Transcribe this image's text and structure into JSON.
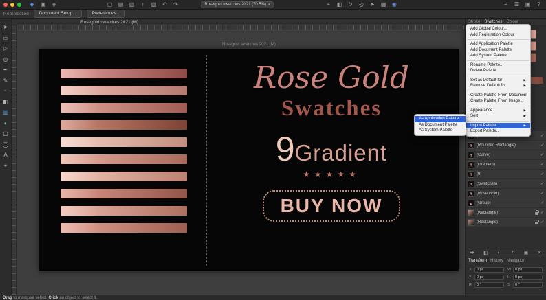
{
  "titlebar": {
    "document_dropdown": "Rosegold swatches 2021 (70.5%)",
    "left_icons": [
      {
        "name": "persona-designer-icon",
        "glyph": "◆",
        "color": "#5a8ee0"
      },
      {
        "name": "persona-pixel-icon",
        "glyph": "▣"
      },
      {
        "name": "persona-export-icon",
        "glyph": "◈"
      }
    ],
    "mid_icons": [
      {
        "name": "new-document-icon",
        "glyph": "▢"
      },
      {
        "name": "open-document-icon",
        "glyph": "▤"
      },
      {
        "name": "save-document-icon",
        "glyph": "▥"
      },
      {
        "name": "export-icon",
        "glyph": "↑"
      },
      {
        "name": "place-image-icon",
        "glyph": "▧"
      },
      {
        "name": "undo-icon",
        "glyph": "↶"
      },
      {
        "name": "redo-icon",
        "glyph": "↷"
      }
    ],
    "right_icons": [
      {
        "name": "snapping-icon",
        "glyph": "⌖"
      },
      {
        "name": "transform-origin-icon",
        "glyph": "◧"
      },
      {
        "name": "rotate-icon",
        "glyph": "↻"
      },
      {
        "name": "zoom-icon",
        "glyph": "◎"
      },
      {
        "name": "pointer-icon",
        "glyph": "➤"
      },
      {
        "name": "grid-icon",
        "glyph": "▦"
      },
      {
        "name": "colour-sync-icon",
        "glyph": "◉",
        "color": "#6a8fe0"
      }
    ],
    "far_right_icons": [
      {
        "name": "separator-toggle-icon",
        "glyph": "≡"
      },
      {
        "name": "hamburger-menu-icon",
        "glyph": "☰"
      },
      {
        "name": "panel-toggle-icon",
        "glyph": "▣"
      },
      {
        "name": "help-icon",
        "glyph": "?"
      }
    ]
  },
  "context_bar": {
    "selection_status": "No Selection",
    "document_setup_label": "Document Setup...",
    "preferences_label": "Preferences..."
  },
  "toolbox": {
    "tools": [
      {
        "name": "move-tool",
        "glyph": "➤"
      },
      {
        "name": "artboard-tool",
        "glyph": "▭"
      },
      {
        "name": "node-tool",
        "glyph": "▷"
      },
      {
        "name": "zoom-tool",
        "glyph": "◎"
      },
      {
        "name": "pen-tool",
        "glyph": "✒"
      },
      {
        "name": "pencil-tool",
        "glyph": "✎"
      },
      {
        "name": "brush-tool",
        "glyph": "~"
      },
      {
        "name": "fill-tool",
        "glyph": "◧"
      },
      {
        "name": "gradient-tool",
        "glyph": "▥",
        "color": "#5aa0d8"
      },
      {
        "name": "transparency-tool",
        "glyph": "◐",
        "color": "#49b6c0"
      },
      {
        "name": "rectangle-tool",
        "glyph": "▢"
      },
      {
        "name": "ellipse-tool",
        "glyph": "◯"
      },
      {
        "name": "text-tool",
        "glyph": "A"
      },
      {
        "name": "colour-picker-tool",
        "glyph": "+"
      }
    ]
  },
  "canvas": {
    "document_tab": "Rosegold swatches 2021 (M)",
    "artboard_name": "Rosegold swatches 2021 (M)"
  },
  "design": {
    "title_line1": "Rose Gold",
    "title_line2": "Swatches",
    "gradient_number": "9",
    "gradient_word": "Gradient",
    "stars": "★★★★★",
    "cta": "BUY NOW",
    "colors": {
      "artboard_bg": "#060606",
      "script": "#c9827c",
      "subtitle": "#a3574c",
      "number": "#eecaba",
      "gradient_word": "#d7a093",
      "stars": "#b2736a",
      "cta": "#e9b6a7",
      "cta_border": "#c48b7c"
    },
    "swatches": [
      {
        "from": "#e2a099",
        "to": "#8e4a47"
      },
      {
        "from": "#f0bfb4",
        "to": "#b37a70"
      },
      {
        "from": "#e3a79b",
        "to": "#a05c52"
      },
      {
        "from": "#cf8a76",
        "to": "#7e4335"
      },
      {
        "from": "#f4d0c3",
        "to": "#c18e80"
      },
      {
        "from": "#e9b0a1",
        "to": "#a96a5b"
      },
      {
        "from": "#f2c6b9",
        "to": "#bb8273"
      },
      {
        "from": "#dd9a8c",
        "to": "#94554a"
      },
      {
        "from": "#eeb9ab",
        "to": "#ad6f60"
      },
      {
        "from": "#e5a494",
        "to": "#9d5f52"
      }
    ]
  },
  "menu": {
    "highlight_color": "#2e62d9",
    "items": [
      {
        "label": "Add Global Colour...",
        "type": "item"
      },
      {
        "label": "Add Registration Colour",
        "type": "item"
      },
      {
        "type": "separator"
      },
      {
        "label": "Add Application Palette",
        "type": "item"
      },
      {
        "label": "Add Document Palette",
        "type": "item"
      },
      {
        "label": "Add System Palette",
        "type": "item"
      },
      {
        "type": "separator"
      },
      {
        "label": "Rename Palette...",
        "type": "item"
      },
      {
        "label": "Delete Palette",
        "type": "item"
      },
      {
        "type": "separator"
      },
      {
        "label": "Set as Default for",
        "type": "item",
        "submenu": true
      },
      {
        "label": "Remove Default for",
        "type": "item",
        "submenu": true
      },
      {
        "type": "separator"
      },
      {
        "label": "Create Palette From Document",
        "type": "item"
      },
      {
        "label": "Create Palette From Image...",
        "type": "item"
      },
      {
        "type": "separator"
      },
      {
        "label": "Appearance",
        "type": "item",
        "submenu": true
      },
      {
        "label": "Sort",
        "type": "item",
        "submenu": true
      },
      {
        "type": "separator"
      },
      {
        "label": "Import Palette...",
        "type": "item",
        "submenu": true,
        "highlighted": true
      },
      {
        "label": "Export Palette...",
        "type": "item"
      }
    ],
    "submenu": {
      "items": [
        {
          "label": "As Application Palette",
          "highlighted": true
        },
        {
          "label": "As Document Palette"
        },
        {
          "label": "As System Palette"
        }
      ]
    }
  },
  "panels": {
    "tabs": [
      "Stroke",
      "Swatches",
      "Colour"
    ],
    "swatch_chips": [
      "#e8b3a9",
      "#d79a8f",
      "#c97b62",
      "#f0c5ba",
      "#b96a58",
      "#e5a89e",
      "#d49588",
      "#eec9bd",
      "#cf8b82",
      "#a95f54",
      "#f2c6b9",
      "#dd9a8c",
      "#e3a79b",
      "#b37a70",
      "#8e4a47",
      "#e2a099",
      "#f4d0c3",
      "#a96a5b",
      "#eeb9ab",
      "#9d5f52"
    ],
    "swatch_gradient": {
      "from": "#f0c4b7",
      "to": "#7e4337"
    },
    "layers": [
      {
        "name": "(BUY NOW)",
        "icon": "A"
      },
      {
        "name": "(Rounded Rectangle)",
        "icon": "A"
      },
      {
        "name": "(Curve)",
        "icon": "A"
      },
      {
        "name": "(Gradient)",
        "icon": "A"
      },
      {
        "name": "(9)",
        "icon": "A"
      },
      {
        "name": "(Swatches)",
        "icon": "A"
      },
      {
        "name": "(Rose Gold)",
        "icon": "A"
      },
      {
        "name": "(Group)",
        "icon": "▸",
        "group": true
      },
      {
        "name": "(Rectangle)",
        "icon": "",
        "thumb": true,
        "locked": true
      },
      {
        "name": "(Rectangle)",
        "icon": "",
        "thumb": true,
        "locked": true
      }
    ],
    "layer_footer_icons": [
      {
        "name": "add-layer-icon",
        "glyph": "✚"
      },
      {
        "name": "mask-layer-icon",
        "glyph": "◧"
      },
      {
        "name": "adjustment-layer-icon",
        "glyph": "◐"
      },
      {
        "name": "layer-effects-icon",
        "glyph": "ƒ"
      },
      {
        "name": "group-layers-icon",
        "glyph": "▣"
      },
      {
        "name": "delete-layer-icon",
        "glyph": "✕"
      }
    ],
    "transform": {
      "tabs": [
        "Transform",
        "History",
        "Navigator"
      ],
      "fields": [
        {
          "label": "X",
          "value": "0 px"
        },
        {
          "label": "W",
          "value": "0 px"
        },
        {
          "label": "Y",
          "value": "0 px"
        },
        {
          "label": "H",
          "value": "0 px"
        },
        {
          "label": "R",
          "value": "0 °"
        },
        {
          "label": "S",
          "value": "0 °"
        }
      ]
    }
  },
  "status_bar": {
    "drag_word": "Drag",
    "drag_rest": " to marquee select. ",
    "click_word": "Click",
    "click_rest": " an object to select it."
  }
}
